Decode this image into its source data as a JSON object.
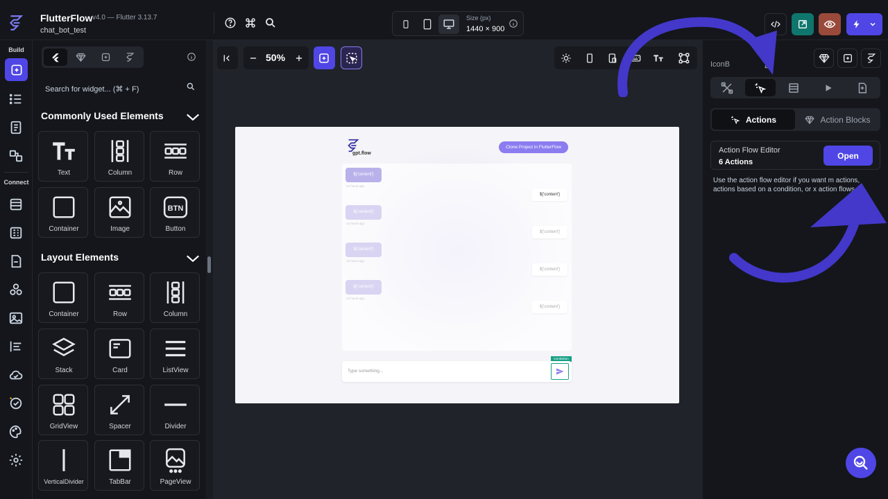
{
  "header": {
    "app_name": "FlutterFlow",
    "version": "v4.0 — Flutter 3.13.7",
    "project": "chat_bot_test",
    "size_label": "Size (px)",
    "size_value": "1440 × 900"
  },
  "rail": {
    "build_label": "Build",
    "connect_label": "Connect"
  },
  "widget_panel": {
    "search_placeholder": "Search for widget... (⌘ + F)",
    "sections": [
      {
        "title": "Commonly Used Elements",
        "items": [
          "Text",
          "Column",
          "Row",
          "Container",
          "Image",
          "Button"
        ]
      },
      {
        "title": "Layout Elements",
        "items": [
          "Container",
          "Row",
          "Column",
          "Stack",
          "Card",
          "ListView",
          "GridView",
          "Spacer",
          "Divider",
          "VerticalDivider",
          "TabBar",
          "PageView"
        ]
      }
    ]
  },
  "canvas": {
    "zoom": "50%",
    "preview": {
      "logo_text": "gpt.flow",
      "clone_button": "Clone Project in FlutterFlow",
      "message_placeholder": "${'content'}",
      "timestamp": "12 hours ago",
      "input_placeholder": "Type something...",
      "icon_button_tag": "IconButton"
    }
  },
  "right_panel": {
    "title": "IconB",
    "seg_actions": "Actions",
    "seg_action_blocks": "Action Blocks",
    "afe_title": "Action Flow Editor",
    "afe_count": "6 Actions",
    "afe_open": "Open",
    "afe_desc": "Use the action flow editor if you want m actions, actions based on a condition, or x action flows."
  },
  "colors": {
    "accent": "#4f46e5",
    "canvas_bg": "#20232a",
    "panel_bg": "#14161b",
    "annotation_arrow": "#4338ca"
  }
}
